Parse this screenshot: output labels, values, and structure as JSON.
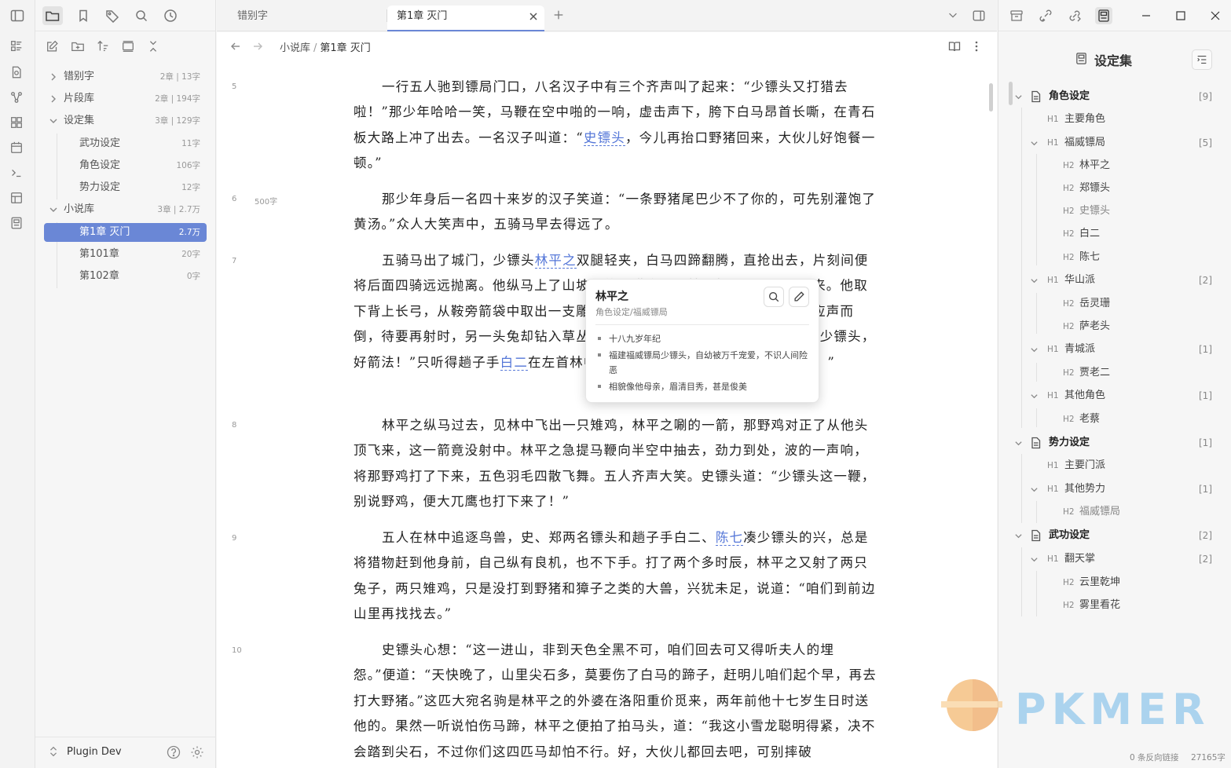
{
  "explorer": {
    "tree": [
      {
        "label": "错别字",
        "count": "2章 | 13字"
      },
      {
        "label": "片段库",
        "count": "2章 | 194字"
      },
      {
        "label": "设定集",
        "count": "3章 | 129字"
      },
      {
        "label": "武功设定",
        "count": "11字"
      },
      {
        "label": "角色设定",
        "count": "106字"
      },
      {
        "label": "势力设定",
        "count": "12字"
      },
      {
        "label": "小说库",
        "count": "3章 | 2.7万"
      },
      {
        "label": "第1章 灭门",
        "count": "2.7万"
      },
      {
        "label": "第101章",
        "count": "20字"
      },
      {
        "label": "第102章",
        "count": "0字"
      }
    ],
    "vault_name": "Plugin Dev"
  },
  "tabs": [
    {
      "label": "错别字"
    },
    {
      "label": "第1章 灭门"
    }
  ],
  "breadcrumb": {
    "parent": "小说库",
    "sep": "/",
    "current": "第1章 灭门"
  },
  "editor": {
    "line_numbers": [
      "5",
      "6",
      "7",
      "8",
      "9",
      "10"
    ],
    "word_marker": "500字",
    "paragraphs": {
      "p5": [
        "一行五人驰到镖局门口，八名汉子中有三个齐声叫了起来：“少镖头又打猎去啦！”那少年哈哈一笑，马鞭在空中啪的一响，虚击声下，胯下白马昂首长嘶，在青石板大路上冲了出去。一名汉子叫道：“",
        "史镖头",
        "，今儿再抬口野猪回来，大伙儿好饱餐一顿。”"
      ],
      "p6": "那少年身后一名四十来岁的汉子笑道：“一条野猪尾巴少不了你的，可先别灌饱了黄汤。”众人大笑声中，五骑马早去得远了。",
      "p7": [
        "五骑马出了城门，少镖头",
        "林平之",
        "双腿轻夹，白马四蹄翻腾，直抢出去，片刻间便将后面四骑远远抛离。他纵马上了山坡，放起猎鹰，从林中赶了一对黄兔出来。他取下背上长弓，从鞍旁箭袋中取出一支雕翎，弯弓搭箭，嗖的一声，一头黄兔应声而倒，待要再射时，另一头兔却钻入草丛中不见了。郑镖头纵马赶到，笑道：“少镖头，好箭法！”只听得趟子手",
        "白二",
        "在左首林中叫道：“少镖头，快来，这里有野鸡！”"
      ],
      "p8": "林平之纵马过去，见林中飞出一只雉鸡，林平之唰的一箭，那野鸡对正了从他头顶飞来，这一箭竟没射中。林平之急提马鞭向半空中抽去，劲力到处，波的一声响，将那野鸡打了下来，五色羽毛四散飞舞。五人齐声大笑。史镖头道：“少镖头这一鞭，别说野鸡，便大兀鹰也打下来了！”",
      "p9": [
        "五人在林中追逐鸟兽，史、郑两名镖头和趟子手白二、",
        "陈七",
        "凑少镖头的兴，总是将猎物赶到他身前，自己纵有良机，也不下手。打了两个多时辰，林平之又射了两只兔子，两只雉鸡，只是没打到野猪和獐子之类的大兽，兴犹未足，说道：“咱们到前边山里再找找去。”"
      ],
      "p10": "史镖头心想：“这一进山，非到天色全黑不可，咱们回去可又得听夫人的埋怨。”便道：“天快晚了，山里尖石多，莫要伤了白马的蹄子，赶明儿咱们起个早，再去打大野猪。”这匹大宛名驹是林平之的外婆在洛阳重价觅来，两年前他十七岁生日时送他的。果然一听说怕伤马蹄，林平之便拍了拍马头，道：“我这小雪龙聪明得紧，决不会踏到尖石，不过你们这四匹马却怕不行。好，大伙儿都回去吧，可别摔破"
    }
  },
  "popover": {
    "title": "林平之",
    "path": "角色设定/福威镖局",
    "items": [
      "十八九岁年纪",
      "福建福威镖局少镖头，自幼被万千宠爱，不识人间险恶",
      "相貌像他母亲，眉清目秀，甚是俊美"
    ]
  },
  "outline": {
    "title": "设定集",
    "items": [
      {
        "text": "角色设定",
        "level": "",
        "count": "[9]"
      },
      {
        "text": "主要角色",
        "level": "H1",
        "count": ""
      },
      {
        "text": "福威镖局",
        "level": "H1",
        "count": "[5]"
      },
      {
        "text": "林平之",
        "level": "H2",
        "count": ""
      },
      {
        "text": "郑镖头",
        "level": "H2",
        "count": ""
      },
      {
        "text": "史镖头",
        "level": "H2",
        "count": ""
      },
      {
        "text": "白二",
        "level": "H2",
        "count": ""
      },
      {
        "text": "陈七",
        "level": "H2",
        "count": ""
      },
      {
        "text": "华山派",
        "level": "H1",
        "count": "[2]"
      },
      {
        "text": "岳灵珊",
        "level": "H2",
        "count": ""
      },
      {
        "text": "萨老头",
        "level": "H2",
        "count": ""
      },
      {
        "text": "青城派",
        "level": "H1",
        "count": "[1]"
      },
      {
        "text": "贾老二",
        "level": "H2",
        "count": ""
      },
      {
        "text": "其他角色",
        "level": "H1",
        "count": "[1]"
      },
      {
        "text": "老蔡",
        "level": "H2",
        "count": ""
      },
      {
        "text": "势力设定",
        "level": "",
        "count": "[1]"
      },
      {
        "text": "主要门派",
        "level": "H1",
        "count": ""
      },
      {
        "text": "其他势力",
        "level": "H1",
        "count": "[1]"
      },
      {
        "text": "福威镖局",
        "level": "H2",
        "count": ""
      },
      {
        "text": "武功设定",
        "level": "",
        "count": "[2]"
      },
      {
        "text": "翻天掌",
        "level": "H1",
        "count": "[2]"
      },
      {
        "text": "云里乾坤",
        "level": "H2",
        "count": ""
      },
      {
        "text": "雾里看花",
        "level": "H2",
        "count": ""
      }
    ]
  },
  "status": {
    "backlinks": "0 条反向链接",
    "words": "27165字"
  },
  "watermark": "PKMER",
  "colors": {
    "accent": "#6a87d6",
    "link": "#5577d8",
    "background": "#f6f6f6"
  }
}
